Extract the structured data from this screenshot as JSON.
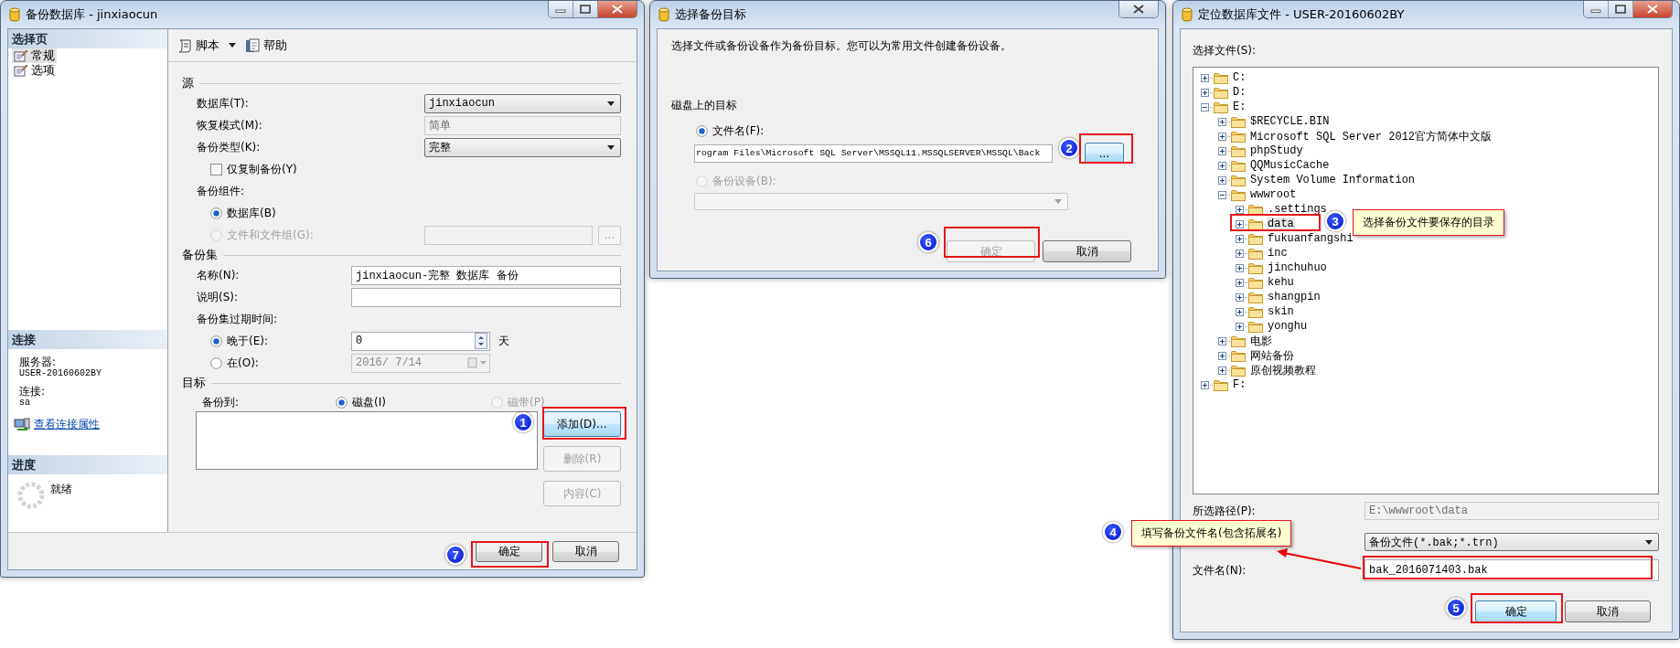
{
  "backup_dialog": {
    "title": "备份数据库 - jinxiaocun",
    "sidebar": {
      "pages_header": "选择页",
      "pages": [
        {
          "label": "常规",
          "selected": true
        },
        {
          "label": "选项",
          "selected": false
        }
      ],
      "connection_header": "连接",
      "server_label": "服务器:",
      "server": "USER-20160602BY",
      "login_label": "连接:",
      "login": "sa",
      "properties_link": "查看连接属性",
      "progress_header": "进度",
      "progress_status": "就绪"
    },
    "toolbar": [
      {
        "kind": "dropdown",
        "label": "脚本"
      },
      {
        "kind": "button",
        "label": "帮助"
      }
    ],
    "sections": [
      {
        "kind": "source",
        "heading": "源",
        "rows": [
          {
            "kind": "select",
            "label": "数据库(T):",
            "value": "jinxiaocun"
          },
          {
            "kind": "readonly",
            "label": "恢复模式(M):",
            "value": "简单"
          },
          {
            "kind": "select",
            "label": "备份类型(K):",
            "value": "完整"
          },
          {
            "kind": "checkbox",
            "label": "仅复制备份(Y)",
            "checked": false
          },
          {
            "kind": "label",
            "label": "备份组件:"
          },
          {
            "kind": "radio",
            "label": "数据库(B)",
            "selected": true,
            "disabled": false
          },
          {
            "kind": "radio_field",
            "label": "文件和文件组(G):",
            "selected": false,
            "disabled": true,
            "browse": "..."
          }
        ]
      },
      {
        "kind": "backup_set",
        "heading": "备份集",
        "rows": [
          {
            "kind": "text",
            "label": "名称(N):",
            "value": "jinxiaocun-完整 数据库 备份"
          },
          {
            "kind": "text",
            "label": "说明(S):"
          },
          {
            "kind": "label",
            "label": "备份集过期时间:"
          },
          {
            "kind": "spinner",
            "label": "晚于(E):",
            "selected": true,
            "disabled": false,
            "value": "0",
            "unit": "天"
          },
          {
            "kind": "date",
            "label": "在(O):",
            "selected": false,
            "disabled": false,
            "value": "2016/ 7/14"
          }
        ]
      }
    ],
    "destination": {
      "heading": "目标",
      "backup_to_label": "备份到:",
      "media": [
        {
          "label": "磁盘(I)",
          "selected": true,
          "disabled": false
        },
        {
          "label": "磁带(P)",
          "selected": false,
          "disabled": true
        }
      ],
      "buttons": [
        {
          "label": "添加(D)...",
          "disabled": false,
          "focused": true
        },
        {
          "label": "删除(R)",
          "disabled": true,
          "focused": false
        },
        {
          "label": "内容(C)",
          "disabled": true,
          "focused": false
        }
      ]
    },
    "footer_buttons": [
      {
        "label": "确定",
        "focused": false
      },
      {
        "label": "取消",
        "focused": false
      }
    ]
  },
  "destination_dialog": {
    "title": "选择备份目标",
    "description": "选择文件或备份设备作为备份目标。您可以为常用文件创建备份设备。",
    "disk_heading": "磁盘上的目标",
    "options": [
      {
        "kind": "text",
        "label": "文件名(F):",
        "selected": true,
        "disabled": false,
        "value": "rogram Files\\Microsoft SQL Server\\MSSQL11.MSSQLSERVER\\MSSQL\\Back"
      },
      {
        "kind": "select",
        "label": "备份设备(B):",
        "selected": false,
        "disabled": true
      }
    ],
    "browse_button": "...",
    "buttons": [
      {
        "label": "确定",
        "disabled": true
      },
      {
        "label": "取消",
        "disabled": false
      }
    ]
  },
  "locate_dialog": {
    "title": "定位数据库文件 - USER-20160602BY",
    "select_label": "选择文件(S):",
    "tree": [
      {
        "label": "C:",
        "expanded": false,
        "selected": false
      },
      {
        "label": "D:",
        "expanded": false,
        "selected": false
      },
      {
        "label": "E:",
        "expanded": true,
        "selected": false,
        "children": [
          {
            "label": "$RECYCLE.BIN",
            "expanded": false,
            "selected": false
          },
          {
            "label": "Microsoft SQL Server 2012官方简体中文版",
            "expanded": false,
            "selected": false
          },
          {
            "label": "phpStudy",
            "expanded": false,
            "selected": false
          },
          {
            "label": "QQMusicCache",
            "expanded": false,
            "selected": false
          },
          {
            "label": "System Volume Information",
            "expanded": false,
            "selected": false
          },
          {
            "label": "wwwroot",
            "expanded": true,
            "selected": false,
            "children": [
              {
                "label": ".settings",
                "expanded": false,
                "selected": false
              },
              {
                "label": "data",
                "expanded": false,
                "selected": true
              },
              {
                "label": "fukuanfangshi",
                "expanded": false,
                "selected": false
              },
              {
                "label": "inc",
                "expanded": false,
                "selected": false
              },
              {
                "label": "jinchuhuo",
                "expanded": false,
                "selected": false
              },
              {
                "label": "kehu",
                "expanded": false,
                "selected": false
              },
              {
                "label": "shangpin",
                "expanded": false,
                "selected": false
              },
              {
                "label": "skin",
                "expanded": false,
                "selected": false
              },
              {
                "label": "yonghu",
                "expanded": false,
                "selected": false
              }
            ]
          },
          {
            "label": "电影",
            "expanded": false,
            "selected": false
          },
          {
            "label": "网站备份",
            "expanded": false,
            "selected": false
          },
          {
            "label": "原创视频教程",
            "expanded": false,
            "selected": false
          }
        ]
      },
      {
        "label": "F:",
        "expanded": false,
        "selected": false
      }
    ],
    "path_label": "所选路径(P):",
    "path": "E:\\wwwroot\\data",
    "filter": "备份文件(*.bak;*.trn)",
    "file_name_label": "文件名(N):",
    "file_name": "bak_2016071403.bak",
    "buttons": [
      {
        "label": "确定",
        "focused": true
      },
      {
        "label": "取消",
        "focused": false
      }
    ]
  },
  "annotations": [
    {
      "number": "1"
    },
    {
      "number": "2"
    },
    {
      "number": "3",
      "note": "选择备份文件要保存的目录"
    },
    {
      "number": "4",
      "note": "填写备份文件名(包含拓展名)"
    },
    {
      "number": "5"
    },
    {
      "number": "6"
    },
    {
      "number": "7"
    }
  ]
}
